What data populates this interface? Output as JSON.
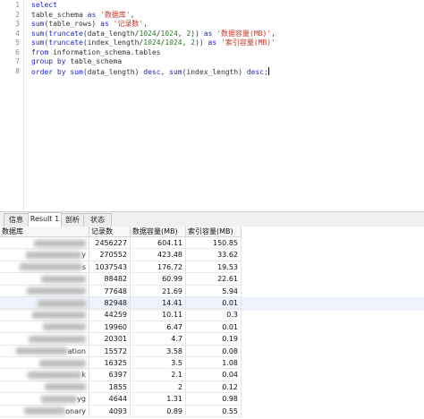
{
  "editor": {
    "lines": [
      {
        "n": "1",
        "tokens": [
          {
            "t": "select",
            "c": "kw"
          }
        ]
      },
      {
        "n": "2",
        "tokens": [
          {
            "t": "table_schema ",
            "c": "plain"
          },
          {
            "t": "as",
            "c": "kw"
          },
          {
            "t": " ",
            "c": "plain"
          },
          {
            "t": "'数据库'",
            "c": "str"
          },
          {
            "t": ",",
            "c": "plain"
          }
        ]
      },
      {
        "n": "3",
        "tokens": [
          {
            "t": "sum",
            "c": "fn"
          },
          {
            "t": "(table_rows) ",
            "c": "plain"
          },
          {
            "t": "as",
            "c": "kw"
          },
          {
            "t": " ",
            "c": "plain"
          },
          {
            "t": "'记录数'",
            "c": "str"
          },
          {
            "t": ",",
            "c": "plain"
          }
        ]
      },
      {
        "n": "4",
        "tokens": [
          {
            "t": "sum",
            "c": "fn"
          },
          {
            "t": "(",
            "c": "plain"
          },
          {
            "t": "truncate",
            "c": "fn"
          },
          {
            "t": "(data_length/",
            "c": "plain"
          },
          {
            "t": "1024",
            "c": "num"
          },
          {
            "t": "/",
            "c": "plain"
          },
          {
            "t": "1024",
            "c": "num"
          },
          {
            "t": ", ",
            "c": "plain"
          },
          {
            "t": "2",
            "c": "num"
          },
          {
            "t": ")) ",
            "c": "plain"
          },
          {
            "t": "as",
            "c": "kw"
          },
          {
            "t": " ",
            "c": "plain"
          },
          {
            "t": "'数据容量(MB)'",
            "c": "str"
          },
          {
            "t": ",",
            "c": "plain"
          }
        ]
      },
      {
        "n": "5",
        "tokens": [
          {
            "t": "sum",
            "c": "fn"
          },
          {
            "t": "(",
            "c": "plain"
          },
          {
            "t": "truncate",
            "c": "fn"
          },
          {
            "t": "(index_length/",
            "c": "plain"
          },
          {
            "t": "1024",
            "c": "num"
          },
          {
            "t": "/",
            "c": "plain"
          },
          {
            "t": "1024",
            "c": "num"
          },
          {
            "t": ", ",
            "c": "plain"
          },
          {
            "t": "2",
            "c": "num"
          },
          {
            "t": ")) ",
            "c": "plain"
          },
          {
            "t": "as",
            "c": "kw"
          },
          {
            "t": " ",
            "c": "plain"
          },
          {
            "t": "'索引容量(MB)'",
            "c": "str"
          }
        ]
      },
      {
        "n": "6",
        "tokens": [
          {
            "t": "from",
            "c": "kw"
          },
          {
            "t": " information_schema.tables",
            "c": "plain"
          }
        ]
      },
      {
        "n": "7",
        "tokens": [
          {
            "t": "group by",
            "c": "kw"
          },
          {
            "t": " table_schema",
            "c": "plain"
          }
        ]
      },
      {
        "n": "8",
        "tokens": [
          {
            "t": "order by",
            "c": "kw"
          },
          {
            "t": " ",
            "c": "plain"
          },
          {
            "t": "sum",
            "c": "fn"
          },
          {
            "t": "(data_length) ",
            "c": "plain"
          },
          {
            "t": "desc",
            "c": "kw"
          },
          {
            "t": ", ",
            "c": "plain"
          },
          {
            "t": "sum",
            "c": "fn"
          },
          {
            "t": "(index_length) ",
            "c": "plain"
          },
          {
            "t": "desc",
            "c": "kw"
          },
          {
            "t": ";",
            "c": "plain"
          }
        ]
      }
    ]
  },
  "tabs": [
    {
      "label": "信息",
      "active": false
    },
    {
      "label": "Result 1",
      "active": true
    },
    {
      "label": "剖析",
      "active": false
    },
    {
      "label": "状态",
      "active": false
    }
  ],
  "table": {
    "columns": [
      "数据库",
      "记录数",
      "数据容量(MB)",
      "索引容量(MB)"
    ],
    "rows": [
      {
        "name": "",
        "rows": "2456227",
        "data": "604.11",
        "index": "150.85"
      },
      {
        "name": "y",
        "rows": "270552",
        "data": "423.48",
        "index": "33.62"
      },
      {
        "name": "s",
        "rows": "1037543",
        "data": "176.72",
        "index": "19.53"
      },
      {
        "name": "",
        "rows": "88482",
        "data": "60.99",
        "index": "22.61"
      },
      {
        "name": "",
        "rows": "77648",
        "data": "21.69",
        "index": "5.94"
      },
      {
        "name": "",
        "rows": "82948",
        "data": "14.41",
        "index": "0.01"
      },
      {
        "name": "",
        "rows": "44259",
        "data": "10.11",
        "index": "0.3"
      },
      {
        "name": "",
        "rows": "19960",
        "data": "6.47",
        "index": "0.01"
      },
      {
        "name": "",
        "rows": "20301",
        "data": "4.7",
        "index": "0.19"
      },
      {
        "name": "ation",
        "rows": "15572",
        "data": "3.58",
        "index": "0.08"
      },
      {
        "name": "",
        "rows": "16325",
        "data": "3.5",
        "index": "1.08"
      },
      {
        "name": "k",
        "rows": "6397",
        "data": "2.1",
        "index": "0.04"
      },
      {
        "name": "",
        "rows": "1855",
        "data": "2",
        "index": "0.12"
      },
      {
        "name": "yg",
        "rows": "4644",
        "data": "1.31",
        "index": "0.98"
      },
      {
        "name": "onary",
        "rows": "4093",
        "data": "0.89",
        "index": "0.55"
      }
    ]
  }
}
